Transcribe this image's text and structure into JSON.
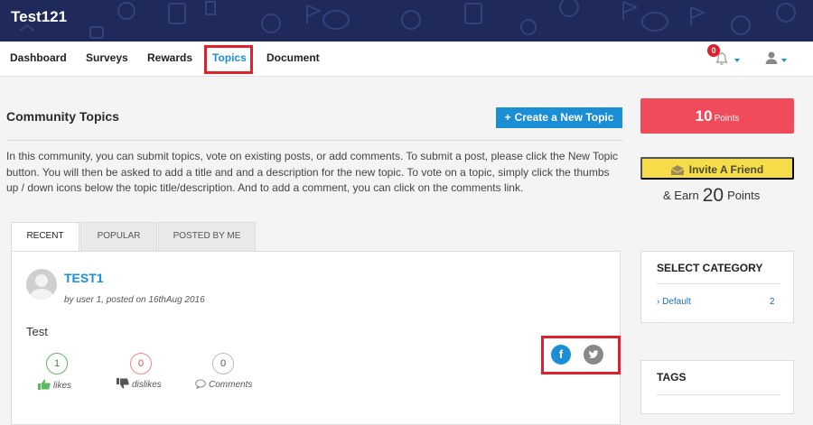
{
  "header": {
    "brand": "Test121"
  },
  "nav": {
    "items": [
      {
        "label": "Dashboard"
      },
      {
        "label": "Surveys"
      },
      {
        "label": "Rewards"
      },
      {
        "label": "Topics",
        "active": true
      },
      {
        "label": "Document"
      }
    ],
    "notification_count": "0"
  },
  "main": {
    "title": "Community Topics",
    "create_button": "Create a New Topic",
    "intro": "In this community, you can submit topics, vote on existing posts, or add comments. To submit a post, please click the New Topic button. You will then be asked to add a title and and a description for the new topic. To vote on a topic, simply click the thumbs up / down icons below the topic title/description. And to add a comment, you can click on the comments link.",
    "tabs": [
      {
        "label": "RECENT",
        "active": true
      },
      {
        "label": "POPULAR"
      },
      {
        "label": "POSTED BY ME"
      }
    ],
    "post": {
      "title": "TEST1",
      "meta": "by user 1, posted on 16thAug 2016",
      "body": "Test",
      "likes": {
        "count": "1",
        "label": "likes"
      },
      "dislikes": {
        "count": "0",
        "label": "dislikes"
      },
      "comments": {
        "count": "0",
        "label": "Comments"
      },
      "share_facebook_glyph": "f"
    }
  },
  "sidebar": {
    "points": {
      "value": "10",
      "label": "Points"
    },
    "invite_button": "Invite A Friend",
    "earn": {
      "prefix": "& Earn",
      "value": "20",
      "suffix": "Points"
    },
    "category": {
      "title": "SELECT CATEGORY",
      "items": [
        {
          "name": "Default",
          "count": "2"
        }
      ]
    },
    "tags": {
      "title": "TAGS"
    }
  },
  "colors": {
    "header_bg": "#1f2a5a",
    "accent_blue": "#1a8fd6",
    "points_red": "#ef4b5a",
    "invite_yellow": "#f7dc4a",
    "highlight_red": "#e0202a"
  }
}
